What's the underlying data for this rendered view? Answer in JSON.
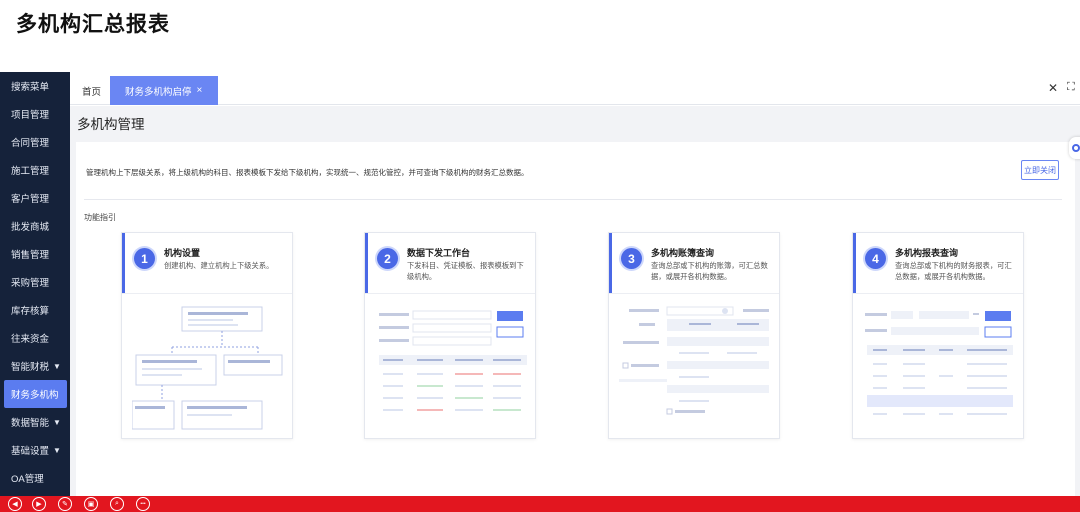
{
  "page_heading": "多机构汇总报表",
  "sidebar": {
    "items": [
      {
        "label": "搜索菜单",
        "caret": false
      },
      {
        "label": "项目管理",
        "caret": false
      },
      {
        "label": "合同管理",
        "caret": false
      },
      {
        "label": "施工管理",
        "caret": false
      },
      {
        "label": "客户管理",
        "caret": false
      },
      {
        "label": "批发商城",
        "caret": false
      },
      {
        "label": "销售管理",
        "caret": false
      },
      {
        "label": "采购管理",
        "caret": false
      },
      {
        "label": "库存核算",
        "caret": false
      },
      {
        "label": "往来资金",
        "caret": false
      },
      {
        "label": "智能财税",
        "caret": true
      },
      {
        "label": "财务多机构",
        "caret": false,
        "active": true
      },
      {
        "label": "数据智能",
        "caret": true
      },
      {
        "label": "基础设置",
        "caret": true
      },
      {
        "label": "OA管理",
        "caret": false
      }
    ]
  },
  "tabs": {
    "home": "首页",
    "active": "财务多机构启停",
    "close_glyph": "×"
  },
  "window_controls": {
    "close": "✕",
    "fullscreen": "⛶"
  },
  "main": {
    "title": "多机构管理",
    "intro": "管理机构上下层级关系，将上级机构的科目、报表模板下发给下级机构，实现统一、规范化管控，并可查询下级机构的财务汇总数据。",
    "close_button": "立即关闭",
    "guide_label": "功能指引",
    "cards": [
      {
        "num": "1",
        "title": "机构设置",
        "desc": "创建机构、建立机构上下级关系。"
      },
      {
        "num": "2",
        "title": "数据下发工作台",
        "desc": "下发科目、凭证模板、报表模板到下级机构。"
      },
      {
        "num": "3",
        "title": "多机构账簿查询",
        "desc": "查询总部或下机构的账簿，可汇总数据，或展开各机构数据。"
      },
      {
        "num": "4",
        "title": "多机构报表查询",
        "desc": "查询总部或下机构的财务报表，可汇总数据，或展开各机构数据。"
      }
    ]
  },
  "colors": {
    "accent": "#4a68e6",
    "sidebar_bg": "#15223a",
    "bottom_bar": "#e2161f"
  },
  "bottom_bar": {
    "buttons": [
      {
        "glyph": "◀",
        "icon": "prev-icon"
      },
      {
        "glyph": "▶",
        "icon": "next-icon"
      },
      {
        "glyph": "✎",
        "icon": "pen-icon"
      },
      {
        "glyph": "▣",
        "icon": "slides-icon"
      },
      {
        "glyph": "⌕",
        "icon": "zoom-icon"
      },
      {
        "glyph": "•••",
        "icon": "more-icon"
      }
    ]
  }
}
